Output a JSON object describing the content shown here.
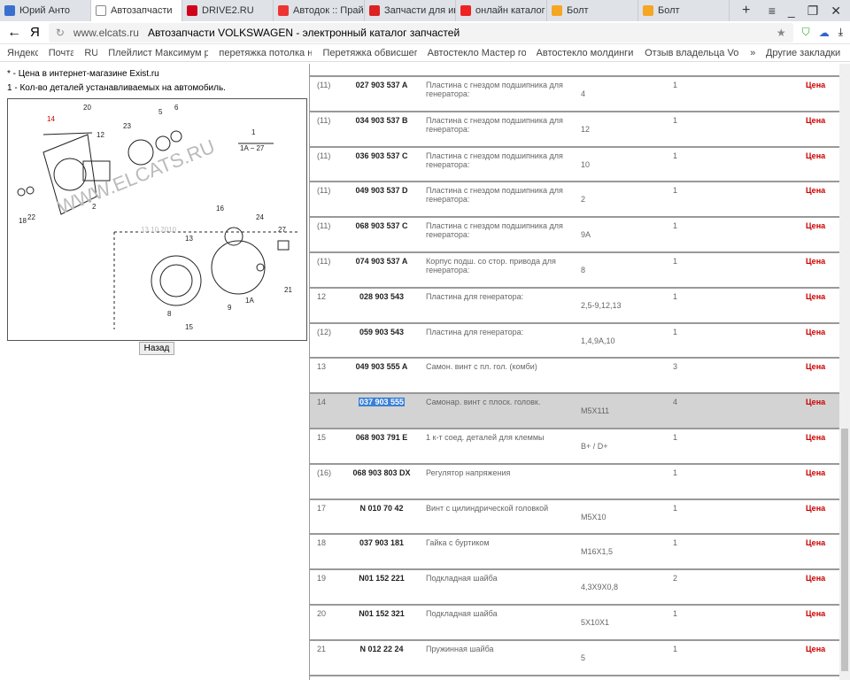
{
  "tabs": [
    {
      "label": "Юрий Анто",
      "color": "#3a6fd0"
    },
    {
      "label": "Автозапчасти",
      "color": "#fff",
      "active": true
    },
    {
      "label": "DRIVE2.RU",
      "color": "#d0021b"
    },
    {
      "label": "Автодок :: Прайс",
      "color": "#e33"
    },
    {
      "label": "Запчасти для ино",
      "color": "#d22"
    },
    {
      "label": "онлайн каталог з",
      "color": "#e22"
    },
    {
      "label": "Болт",
      "color": "#f5a623"
    },
    {
      "label": "Болт",
      "color": "#f5a623"
    }
  ],
  "address": {
    "domain": "www.elcats.ru",
    "title": "Автозапчасти VOLKSWAGEN - электронный каталог запчастей"
  },
  "bookmarks": [
    "Яндекс",
    "Почта",
    "RU",
    "Плейлист Максимум ра",
    "перетяжка потолка на",
    "Перетяжка обвисшего",
    "Автостекло Мастер гор",
    "Автостекло молдинги т",
    "Отзыв владельца Volk",
    "»"
  ],
  "other_bookmarks": "Другие закладки ▾",
  "notes": {
    "price": "* - Цена в интернет-магазине Exist.ru",
    "qty": "1 - Кол-во деталей устанавливаемых на автомобиль."
  },
  "watermark": "WWW.ELCATS.RU",
  "watermark_date": "13.10.2010",
  "back_button": "Назад",
  "rows": [
    {
      "pos": "(11)",
      "num": "027 903 537 A",
      "name": "Пластина с гнездом подшипника для генератора:",
      "note": "4",
      "qty": "1",
      "price": "Цена"
    },
    {
      "pos": "(11)",
      "num": "034 903 537 B",
      "name": "Пластина с гнездом подшипника для генератора:",
      "note": "12",
      "qty": "1",
      "price": "Цена"
    },
    {
      "pos": "(11)",
      "num": "036 903 537 C",
      "name": "Пластина с гнездом подшипника для генератора:",
      "note": "10",
      "qty": "1",
      "price": "Цена"
    },
    {
      "pos": "(11)",
      "num": "049 903 537 D",
      "name": "Пластина с гнездом подшипника для генератора:",
      "note": "2",
      "qty": "1",
      "price": "Цена"
    },
    {
      "pos": "(11)",
      "num": "068 903 537 C",
      "name": "Пластина с гнездом подшипника для генератора:",
      "note": "9A",
      "qty": "1",
      "price": "Цена"
    },
    {
      "pos": "(11)",
      "num": "074 903 537 A",
      "name": "Корпус подш. со стор. привода для генератора:",
      "note": "8",
      "qty": "1",
      "price": "Цена"
    },
    {
      "pos": "12",
      "num": "028 903 543",
      "name": "Пластина для генератора:",
      "note": "2,5-9,12,13",
      "qty": "1",
      "price": "Цена"
    },
    {
      "pos": "(12)",
      "num": "059 903 543",
      "name": "Пластина для генератора:",
      "note": "1,4,9A,10",
      "qty": "1",
      "price": "Цена"
    },
    {
      "pos": "13",
      "num": "049 903 555 A",
      "name": "Самон. винт с пл. гол. (комби)",
      "note": "",
      "qty": "3",
      "price": "Цена"
    },
    {
      "pos": "14",
      "num": "037 903 555",
      "name": "Самонар. винт с плоск. головк.",
      "note": "M5X111",
      "qty": "4",
      "price": "Цена",
      "selected": true
    },
    {
      "pos": "15",
      "num": "068 903 791 E",
      "name": "1 к-т соед. деталей для клеммы",
      "note": "B+ / D+",
      "qty": "1",
      "price": "Цена"
    },
    {
      "pos": "(16)",
      "num": "068 903 803 DX",
      "name": "Регулятор напряжения",
      "note": "",
      "qty": "1",
      "price": "Цена"
    },
    {
      "pos": "17",
      "num": "N 010 70 42",
      "name": "Винт с цилиндрической головкой",
      "note": "M5X10",
      "qty": "1",
      "price": "Цена"
    },
    {
      "pos": "18",
      "num": "037 903 181",
      "name": "Гайка с буртиком",
      "note": "M16X1,5",
      "qty": "1",
      "price": "Цена"
    },
    {
      "pos": "19",
      "num": "N01 152 221",
      "name": "Подкладная шайба",
      "note": "4,3X9X0,8",
      "qty": "2",
      "price": "Цена"
    },
    {
      "pos": "20",
      "num": "N01 152 321",
      "name": "Подкладная шайба",
      "note": "5X10X1",
      "qty": "1",
      "price": "Цена"
    },
    {
      "pos": "21",
      "num": "N 012 22 24",
      "name": "Пружинная шайба",
      "note": "5",
      "qty": "1",
      "price": "Цена"
    }
  ]
}
